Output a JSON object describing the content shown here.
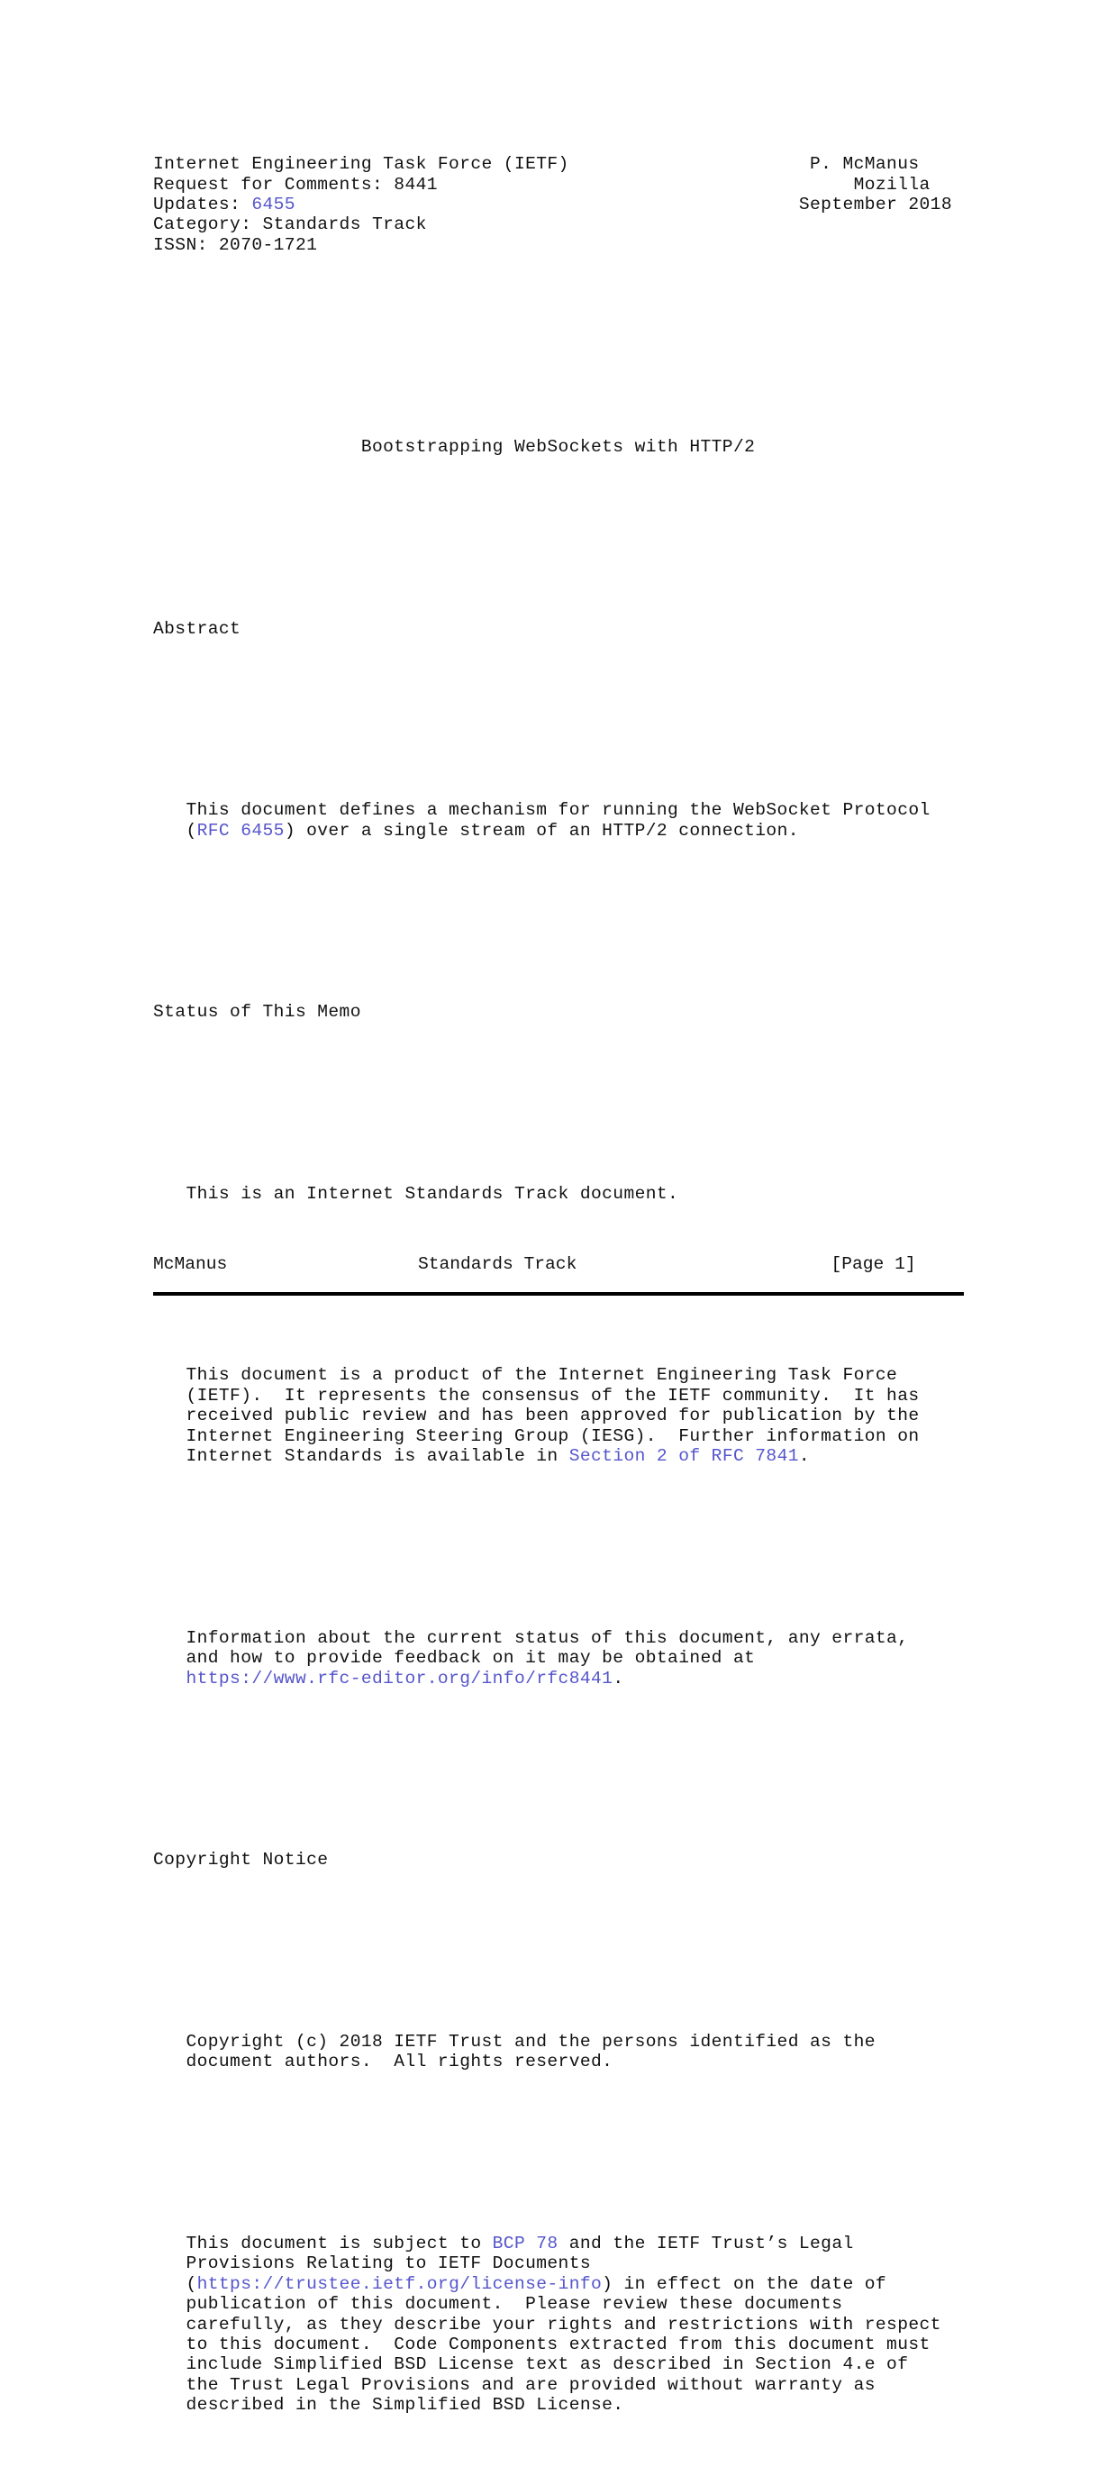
{
  "document": {
    "kind": "rfc-text",
    "link_color": "#5555cc",
    "text_color": "#111111",
    "background": "#ffffff"
  },
  "header": {
    "left": [
      "Internet Engineering Task Force (IETF)",
      "Request for Comments: 8441",
      "Updates: ",
      "Category: Standards Track",
      "ISSN: 2070-1721"
    ],
    "updates_link": "6455",
    "right": [
      "P. McManus",
      "Mozilla",
      "September 2018"
    ],
    "line1": "Internet Engineering Task Force (IETF)                      P. McManus",
    "line2": "Request for Comments: 8441                                      Mozilla",
    "line3_prefix": "Updates: ",
    "line3_suffix": "                                              September 2018",
    "line4": "Category: Standards Track",
    "line5": "ISSN: 2070-1721"
  },
  "title": {
    "text": "Bootstrapping WebSockets with HTTP/2",
    "line": "                   Bootstrapping WebSockets with HTTP/2"
  },
  "sections": {
    "abstract": {
      "heading": "Abstract",
      "body_line1": "   This document defines a mechanism for running the WebSocket Protocol",
      "body_line2_open": "   (",
      "body_line2_link": "RFC 6455",
      "body_line2_rest": ") over a single stream of an HTTP/2 connection."
    },
    "status": {
      "heading": "Status of This Memo",
      "para1": "   This is an Internet Standards Track document.",
      "para2_lines": [
        "   This document is a product of the Internet Engineering Task Force",
        "   (IETF).  It represents the consensus of the IETF community.  It has",
        "   received public review and has been approved for publication by the",
        "   Internet Engineering Steering Group (IESG).  Further information on"
      ],
      "para2_last_prefix": "   Internet Standards is available in ",
      "para2_last_link": "Section 2 of RFC 7841",
      "para2_last_suffix": ".",
      "para3_lines": [
        "   Information about the current status of this document, any errata,",
        "   and how to provide feedback on it may be obtained at"
      ],
      "para3_last_prefix": "   ",
      "para3_last_link": "https://www.rfc-editor.org/info/rfc8441",
      "para3_last_suffix": "."
    },
    "copyright": {
      "heading": "Copyright Notice",
      "para1_lines": [
        "   Copyright (c) 2018 IETF Trust and the persons identified as the",
        "   document authors.  All rights reserved."
      ],
      "para2_line1_prefix": "   This document is subject to ",
      "para2_line1_link": "BCP 78",
      "para2_line1_suffix": " and the IETF Trust’s Legal",
      "para2_line2": "   Provisions Relating to IETF Documents",
      "para2_line3_prefix": "   (",
      "para2_line3_link": "https://trustee.ietf.org/license-info",
      "para2_line3_suffix": ") in effect on the date of",
      "para2_rest_lines": [
        "   publication of this document.  Please review these documents",
        "   carefully, as they describe your rights and restrictions with respect",
        "   to this document.  Code Components extracted from this document must",
        "   include Simplified BSD License text as described in Section 4.e of",
        "   the Trust Legal Provisions and are provided without warranty as",
        "   described in the Simplified BSD License."
      ]
    }
  },
  "footer": {
    "author": "McManus",
    "category": "Standards Track",
    "page": "[Page 1]",
    "line": "McManus                  Standards Track                        [Page 1]"
  }
}
